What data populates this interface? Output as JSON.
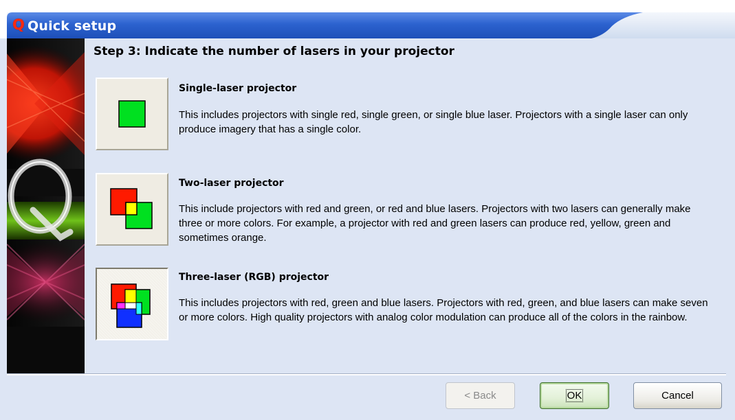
{
  "window": {
    "title": "Quick setup",
    "logo_letter": "Q"
  },
  "step": {
    "heading": "Step 3: Indicate the number of lasers in your projector"
  },
  "options": [
    {
      "title": "Single-laser projector",
      "description": "This includes projectors with single red, single green, or single blue laser. Projectors with a single laser can only produce imagery that has a single color.",
      "icon": "single-laser-icon"
    },
    {
      "title": "Two-laser projector",
      "description": "This include projectors with red and green, or red and blue lasers. Projectors with two lasers can generally make three or more colors. For example, a projector with red and green lasers can produce red, yellow, green and sometimes orange.",
      "icon": "two-laser-icon"
    },
    {
      "title": "Three-laser (RGB) projector",
      "description": "This includes projectors with red, green and blue lasers. Projectors with red, green, and blue lasers can make seven or more colors. High quality projectors with analog color modulation can produce all of the colors in the rainbow.",
      "icon": "three-laser-icon",
      "selected": true
    }
  ],
  "buttons": {
    "back": "< Back",
    "ok": "OK",
    "cancel": "Cancel"
  },
  "colors": {
    "title_bar": "#2f62c9",
    "panel": "#dde5f4",
    "laser_red": "#ff1a00",
    "laser_green": "#00e020",
    "laser_blue": "#1030ff"
  }
}
